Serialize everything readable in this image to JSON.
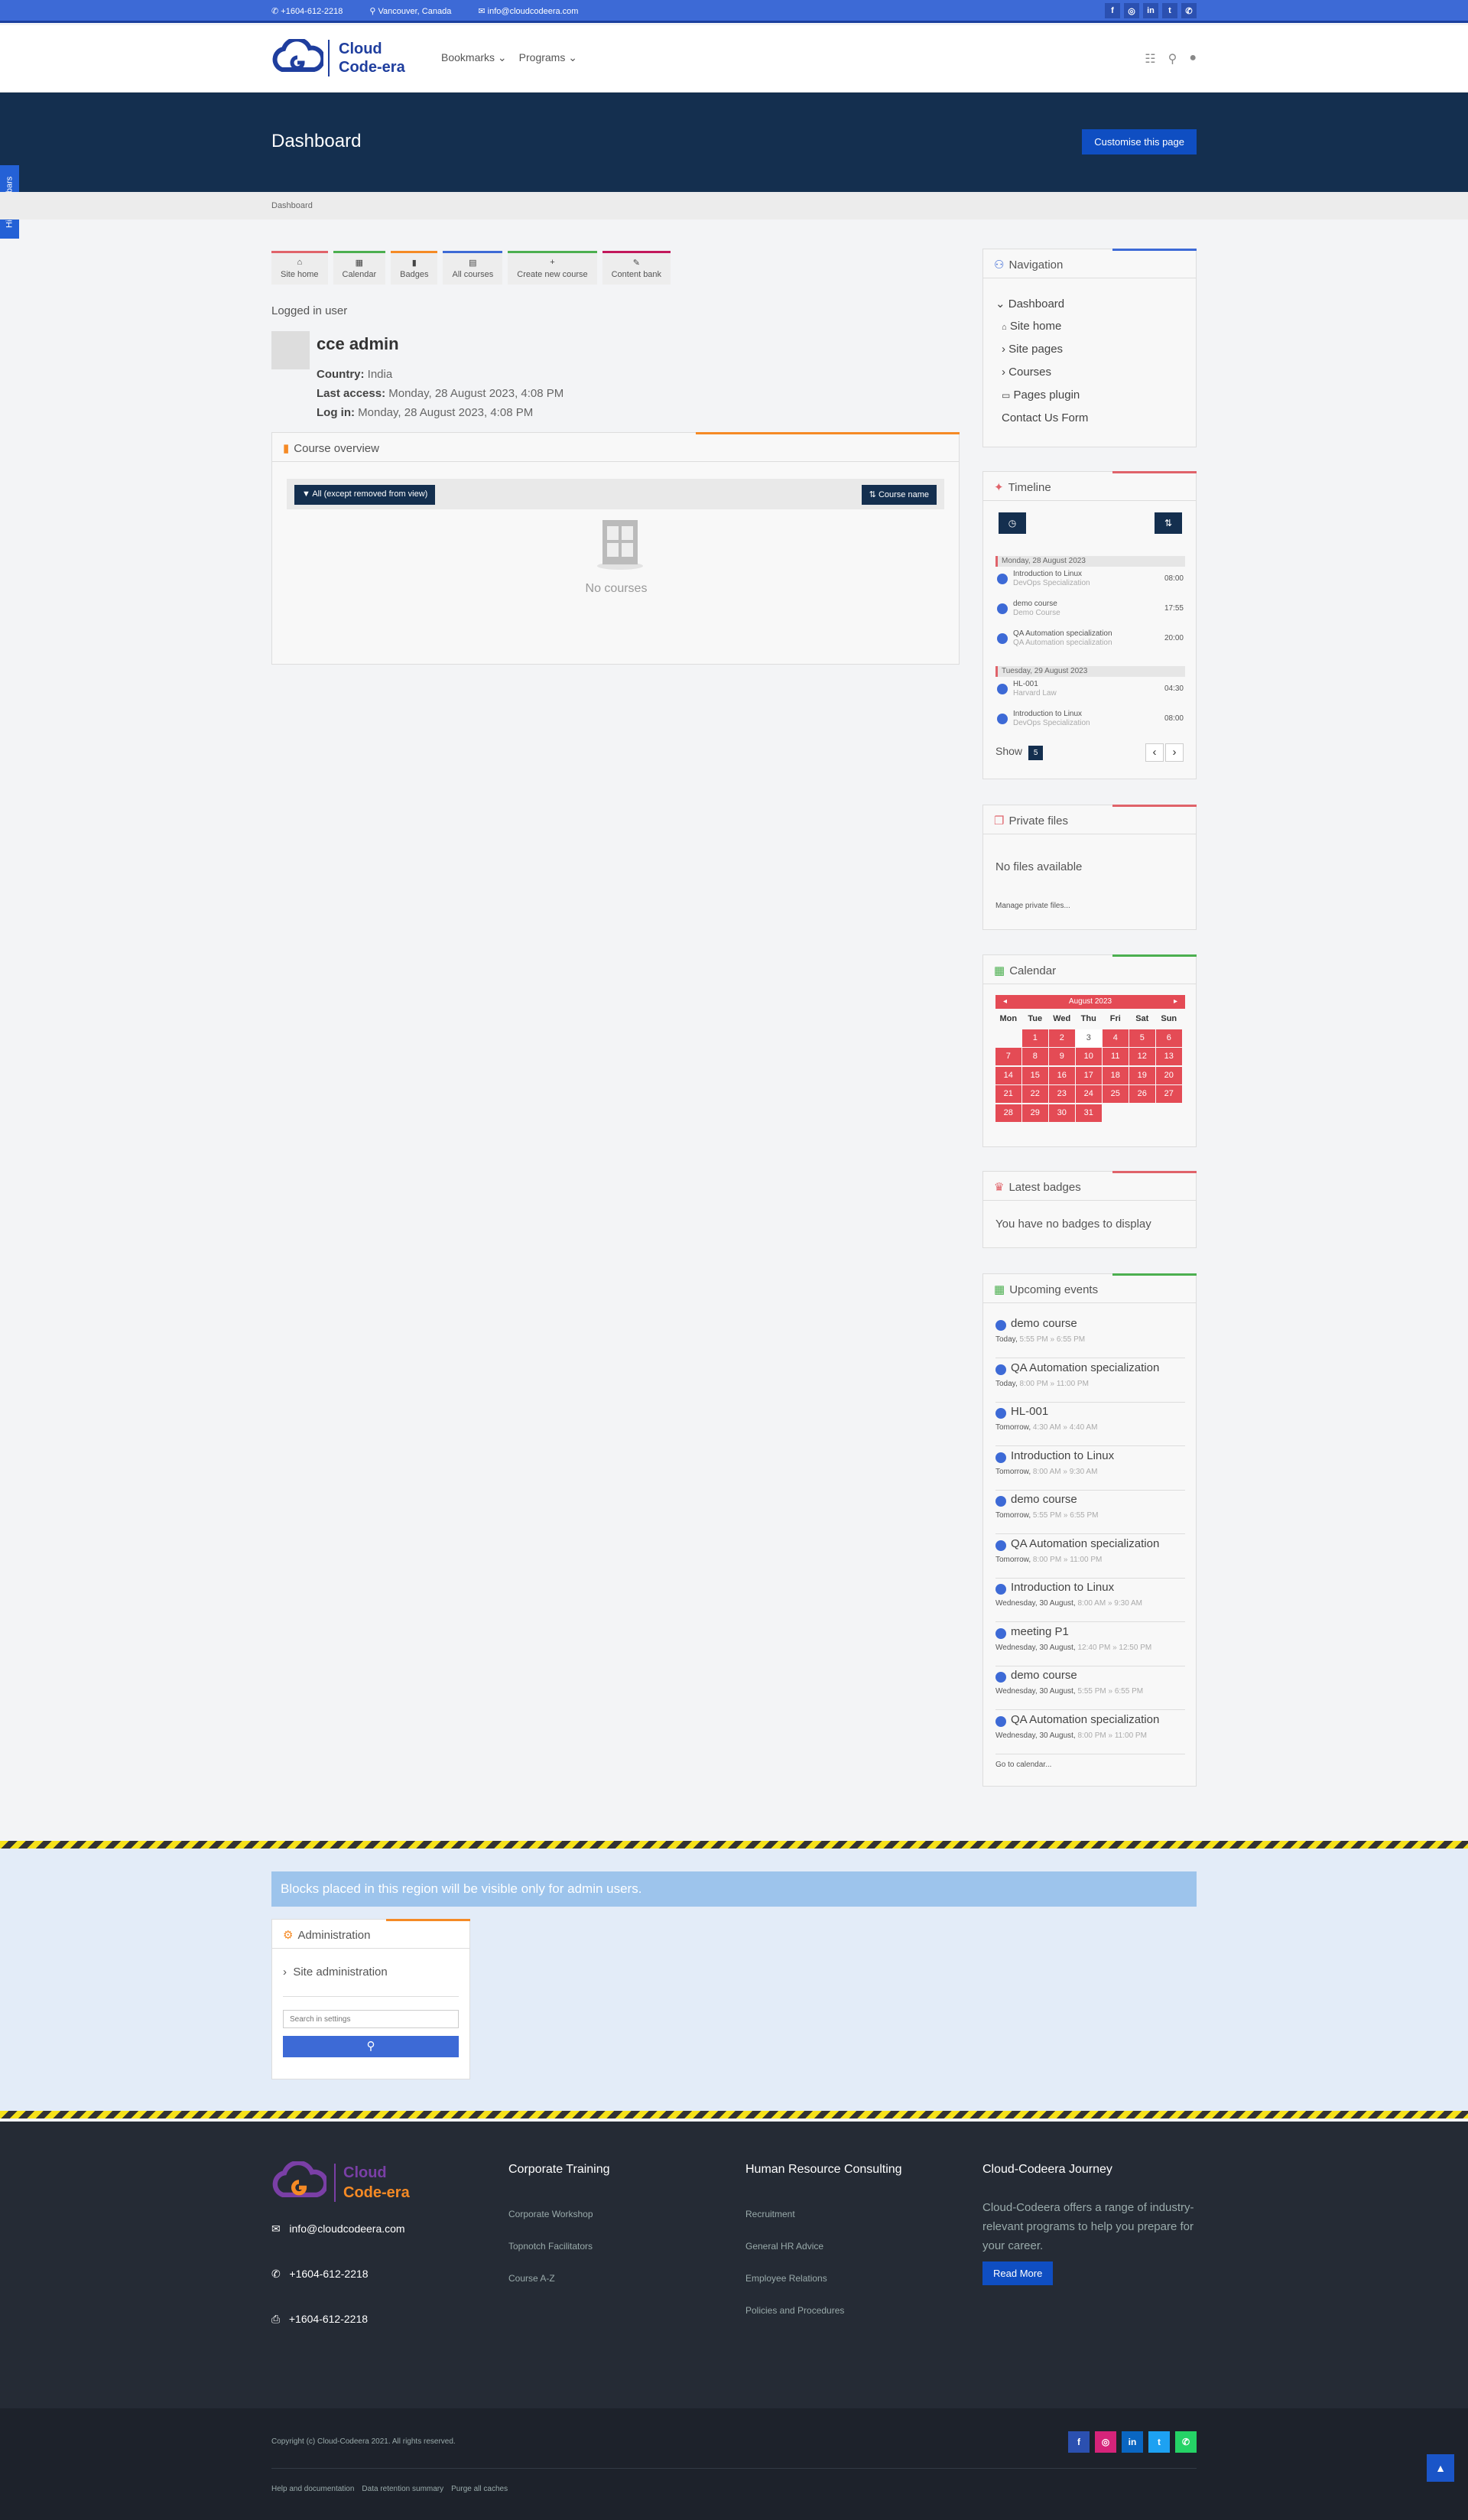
{
  "topbar": {
    "phone": "+1604-612-2218",
    "location": "Vancouver, Canada",
    "email": "info@cloudcodeera.com",
    "social": [
      "f",
      "ig",
      "in",
      "tw",
      "wa"
    ]
  },
  "header": {
    "logo_line1": "Cloud",
    "logo_line2": "Code-era",
    "menu": [
      "Bookmarks",
      "Programs"
    ]
  },
  "page": {
    "title": "Dashboard",
    "customise_button": "Customise this page",
    "hide_sidebars": "Hide sidebars",
    "breadcrumb": "Dashboard"
  },
  "tiles": [
    "Site home",
    "Calendar",
    "Badges",
    "All courses",
    "Create new course",
    "Content bank"
  ],
  "user": {
    "section_label": "Logged in user",
    "name": "cce admin",
    "country_label": "Country:",
    "country": "India",
    "last_access_label": "Last access:",
    "last_access": "Monday, 28 August 2023, 4:08 PM",
    "login_label": "Log in:",
    "login": "Monday, 28 August 2023, 4:08 PM"
  },
  "course_overview": {
    "title": "Course overview",
    "filter": "All (except removed from view)",
    "sort": "Course name",
    "empty": "No courses"
  },
  "navigation": {
    "title": "Navigation",
    "items": [
      "Dashboard",
      "Site home",
      "Site pages",
      "Courses",
      "Pages plugin",
      "Contact Us Form"
    ]
  },
  "timeline": {
    "title": "Timeline",
    "days": [
      {
        "date": "Monday, 28 August 2023",
        "events": [
          {
            "name": "Introduction to Linux",
            "course": "DevOps Specialization",
            "time": "08:00"
          },
          {
            "name": "demo course",
            "course": "Demo Course",
            "time": "17:55"
          },
          {
            "name": "QA Automation specialization",
            "course": "QA Automation specialization",
            "time": "20:00"
          }
        ]
      },
      {
        "date": "Tuesday, 29 August 2023",
        "events": [
          {
            "name": "HL-001",
            "course": "Harvard Law",
            "time": "04:30"
          },
          {
            "name": "Introduction to Linux",
            "course": "DevOps Specialization",
            "time": "08:00"
          }
        ]
      }
    ],
    "show_label": "Show",
    "show_value": "5"
  },
  "private_files": {
    "title": "Private files",
    "empty": "No files available",
    "manage": "Manage private files..."
  },
  "calendar": {
    "title": "Calendar",
    "month": "August 2023",
    "dows": [
      "Mon",
      "Tue",
      "Wed",
      "Thu",
      "Fri",
      "Sat",
      "Sun"
    ],
    "days": [
      "",
      "1",
      "2",
      "3",
      "4",
      "5",
      "6",
      "7",
      "8",
      "9",
      "10",
      "11",
      "12",
      "13",
      "14",
      "15",
      "16",
      "17",
      "18",
      "19",
      "20",
      "21",
      "22",
      "23",
      "24",
      "25",
      "26",
      "27",
      "28",
      "29",
      "30",
      "31"
    ]
  },
  "badges": {
    "title": "Latest badges",
    "empty": "You have no badges to display"
  },
  "upcoming": {
    "title": "Upcoming events",
    "events": [
      {
        "name": "demo course",
        "day": "Today,",
        "time": "5:55 PM » 6:55 PM"
      },
      {
        "name": "QA Automation specialization",
        "day": "Today,",
        "time": "8:00 PM » 11:00 PM"
      },
      {
        "name": "HL-001",
        "day": "Tomorrow,",
        "time": "4:30 AM » 4:40 AM"
      },
      {
        "name": "Introduction to Linux",
        "day": "Tomorrow,",
        "time": "8:00 AM » 9:30 AM"
      },
      {
        "name": "demo course",
        "day": "Tomorrow,",
        "time": "5:55 PM » 6:55 PM"
      },
      {
        "name": "QA Automation specialization",
        "day": "Tomorrow,",
        "time": "8:00 PM » 11:00 PM"
      },
      {
        "name": "Introduction to Linux",
        "day": "Wednesday, 30 August,",
        "time": "8:00 AM » 9:30 AM"
      },
      {
        "name": "meeting P1",
        "day": "Wednesday, 30 August,",
        "time": "12:40 PM » 12:50 PM"
      },
      {
        "name": "demo course",
        "day": "Wednesday, 30 August,",
        "time": "5:55 PM » 6:55 PM"
      },
      {
        "name": "QA Automation specialization",
        "day": "Wednesday, 30 August,",
        "time": "8:00 PM » 11:00 PM"
      }
    ],
    "go_to": "Go to calendar..."
  },
  "admin": {
    "note": "Blocks placed in this region will be visible only for admin users.",
    "title": "Administration",
    "site_admin": "Site administration",
    "search_placeholder": "Search in settings"
  },
  "footer": {
    "logo_line1": "Cloud",
    "logo_line2": "Code-era",
    "email": "info@cloudcodeera.com",
    "phone": "+1604-612-2218",
    "fax": "+1604-612-2218",
    "col1_title": "Corporate Training",
    "col1_links": [
      "Corporate Workshop",
      "Topnotch Facilitators",
      "Course A-Z"
    ],
    "col2_title": "Human Resource Consulting",
    "col2_links": [
      "Recruitment",
      "General HR Advice",
      "Employee Relations",
      "Policies and Procedures"
    ],
    "col3_title": "Cloud-Codeera Journey",
    "col3_text": "Cloud-Codeera offers a range of industry-relevant programs to help you prepare for your career.",
    "read_more": "Read More",
    "copyright": "Copyright (c) Cloud-Codeera 2021. All rights reserved.",
    "bottom_links": [
      "Help and documentation",
      "Data retention summary",
      "Purge all caches"
    ],
    "social": [
      "f",
      "ig",
      "in",
      "tw",
      "wa"
    ]
  },
  "colors": {
    "topbar": "#3d6ad6",
    "pagehead": "#142f4f",
    "calendar_red": "#e44b55",
    "accent_orange": "#f58a25",
    "footer": "#252b35"
  }
}
